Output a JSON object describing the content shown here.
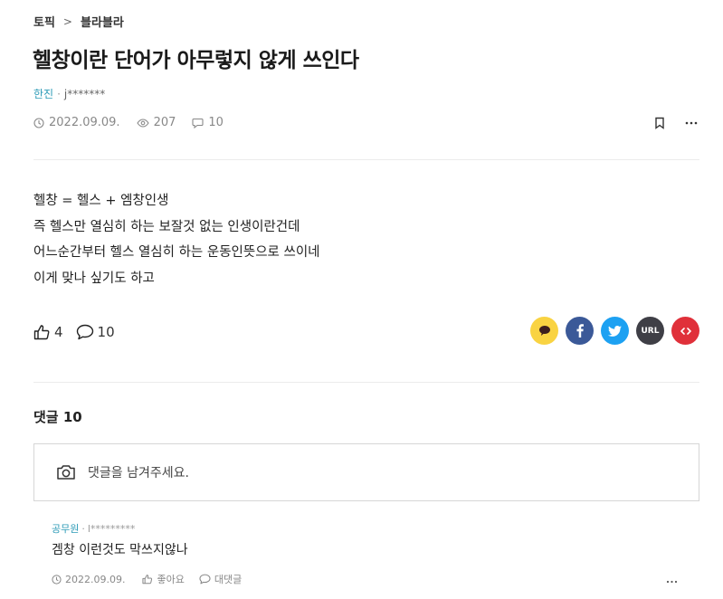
{
  "breadcrumb": {
    "topic": "토픽",
    "separator": ">",
    "board": "블라블라"
  },
  "post": {
    "title": "헬창이란 단어가 아무렇지 않게 쓰인다",
    "author_company": "한진",
    "author_id": "j*******",
    "date": "2022.09.09.",
    "views": "207",
    "comment_count": "10",
    "body_lines": [
      "헬창 = 헬스 + 엠창인생",
      "즉 헬스만 열심히 하는 보잘것 없는 인생이란건데",
      "어느순간부터 헬스 열심히 하는 운동인뜻으로 쓰이네",
      "이게 맞나 싶기도 하고"
    ],
    "likes": "4",
    "comments": "10"
  },
  "share": {
    "url_label": "URL",
    "colors": {
      "kakao": "#f9d342",
      "facebook": "#3b5998",
      "twitter": "#1da1f2",
      "url": "#3f3f46",
      "embed": "#e0303a"
    }
  },
  "comments_section": {
    "title": "댓글 10",
    "input_placeholder": "댓글을 남겨주세요.",
    "items": [
      {
        "company": "공무원",
        "user": "l*********",
        "text": "겜창 이런것도 막쓰지않나",
        "date": "2022.09.09.",
        "like_label": "좋아요",
        "reply_label": "대댓글"
      }
    ]
  },
  "colors": {
    "accent": "#2d9bb7",
    "text": "#222222",
    "muted": "#888888",
    "border": "#d6d6d6"
  }
}
